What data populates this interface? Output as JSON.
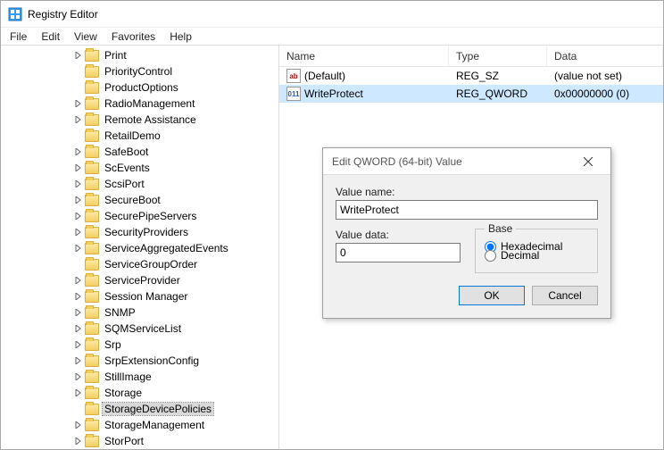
{
  "window": {
    "title": "Registry Editor"
  },
  "menubar": {
    "items": [
      "File",
      "Edit",
      "View",
      "Favorites",
      "Help"
    ]
  },
  "tree": {
    "items": [
      {
        "label": "Print",
        "exp": true
      },
      {
        "label": "PriorityControl",
        "exp": false
      },
      {
        "label": "ProductOptions",
        "exp": false
      },
      {
        "label": "RadioManagement",
        "exp": true
      },
      {
        "label": "Remote Assistance",
        "exp": true
      },
      {
        "label": "RetailDemo",
        "exp": false
      },
      {
        "label": "SafeBoot",
        "exp": true
      },
      {
        "label": "ScEvents",
        "exp": true
      },
      {
        "label": "ScsiPort",
        "exp": true
      },
      {
        "label": "SecureBoot",
        "exp": true
      },
      {
        "label": "SecurePipeServers",
        "exp": true
      },
      {
        "label": "SecurityProviders",
        "exp": true
      },
      {
        "label": "ServiceAggregatedEvents",
        "exp": true
      },
      {
        "label": "ServiceGroupOrder",
        "exp": false
      },
      {
        "label": "ServiceProvider",
        "exp": true
      },
      {
        "label": "Session Manager",
        "exp": true
      },
      {
        "label": "SNMP",
        "exp": true
      },
      {
        "label": "SQMServiceList",
        "exp": true
      },
      {
        "label": "Srp",
        "exp": true
      },
      {
        "label": "SrpExtensionConfig",
        "exp": true
      },
      {
        "label": "StillImage",
        "exp": true
      },
      {
        "label": "Storage",
        "exp": true
      },
      {
        "label": "StorageDevicePolicies",
        "exp": false,
        "selected": true
      },
      {
        "label": "StorageManagement",
        "exp": true
      },
      {
        "label": "StorPort",
        "exp": true
      }
    ]
  },
  "list": {
    "columns": [
      "Name",
      "Type",
      "Data"
    ],
    "rows": [
      {
        "icon": "str",
        "name": "(Default)",
        "type": "REG_SZ",
        "data": "(value not set)",
        "selected": false
      },
      {
        "icon": "bin",
        "name": "WriteProtect",
        "type": "REG_QWORD",
        "data": "0x00000000 (0)",
        "selected": true
      }
    ]
  },
  "dialog": {
    "title": "Edit QWORD (64-bit) Value",
    "valueNameLabel": "Value name:",
    "valueName": "WriteProtect",
    "valueDataLabel": "Value data:",
    "valueData": "0",
    "baseLabel": "Base",
    "hexLabel": "Hexadecimal",
    "decLabel": "Decimal",
    "okLabel": "OK",
    "cancelLabel": "Cancel"
  }
}
